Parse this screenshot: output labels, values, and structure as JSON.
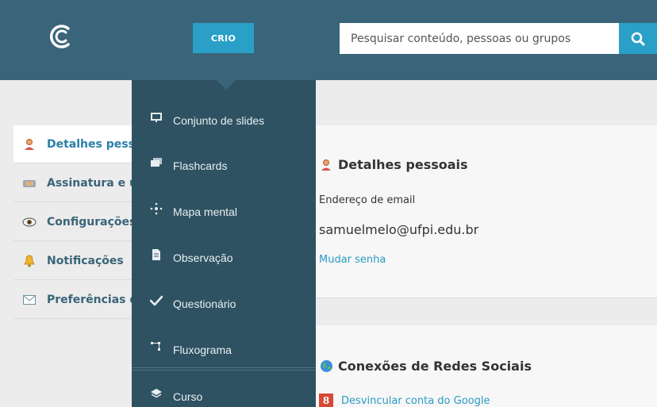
{
  "header": {
    "create_button": "CRIO",
    "search_placeholder": "Pesquisar conteúdo, pessoas ou grupos"
  },
  "left_nav": {
    "items": [
      {
        "label": "Detalhes pessoais",
        "icon": "person-icon",
        "active": true
      },
      {
        "label": "Assinatura e upgrade",
        "icon": "handshake-icon",
        "active": false
      },
      {
        "label": "Configurações",
        "icon": "eye-icon",
        "active": false
      },
      {
        "label": "Notificações",
        "icon": "bell-icon",
        "active": false
      },
      {
        "label": "Preferências de email",
        "icon": "envelope-icon",
        "active": false
      }
    ]
  },
  "dropdown": {
    "items": [
      {
        "label": "Conjunto de slides",
        "icon": "slides-icon"
      },
      {
        "label": "Flashcards",
        "icon": "flashcards-icon"
      },
      {
        "label": "Mapa mental",
        "icon": "mindmap-icon"
      },
      {
        "label": "Observação",
        "icon": "note-icon"
      },
      {
        "label": "Questionário",
        "icon": "checkmark-icon"
      },
      {
        "label": "Fluxograma",
        "icon": "flowchart-icon"
      },
      {
        "label": "Curso",
        "icon": "course-layers-icon"
      }
    ]
  },
  "personal_details": {
    "title": "Detalhes pessoais",
    "email_label": "Endereço de email",
    "email_value": "samuelmelo@ufpi.edu.br",
    "change_password": "Mudar senha"
  },
  "social": {
    "title": "Conexões de Redes Sociais",
    "google_unlink": "Desvincular conta do Google",
    "google_glyph": "8"
  },
  "colors": {
    "header_bg": "#3a6479",
    "accent": "#2aa0c8",
    "dropdown_bg": "#2e5262",
    "link": "#2a9bc4"
  }
}
